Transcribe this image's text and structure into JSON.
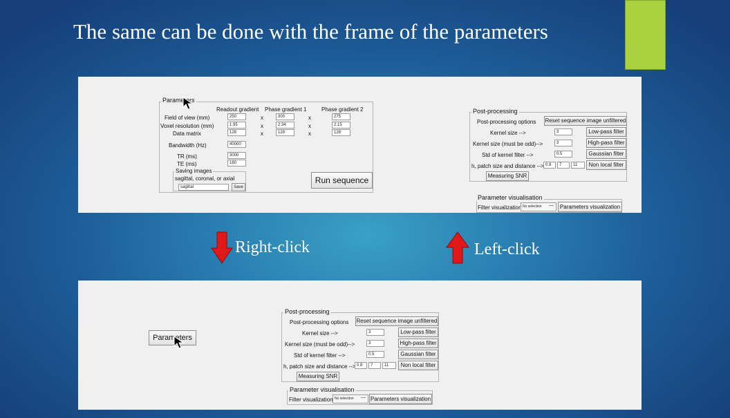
{
  "slide": {
    "title": "The same can be done with the frame of the parameters",
    "accent_color": "#a9d23e",
    "right_click_label": "Right-click",
    "left_click_label": "Left-click",
    "down_arrow_color": "#e01818",
    "up_arrow_color": "#e01818"
  },
  "parameters": {
    "legend": "Parameters",
    "col_readout": "Readout gradient",
    "col_phase1": "Phase gradient 1",
    "col_phase2": "Phase gradient 2",
    "rows": [
      {
        "label": "Field of view (mm)",
        "v1": "250",
        "v2": "300",
        "v3": "275"
      },
      {
        "label": "Voxel resolution (mm)",
        "v1": "1.95",
        "v2": "2.34",
        "v3": "2.15"
      },
      {
        "label": "Data matrix",
        "v1": "128",
        "v2": "128",
        "v3": "128"
      }
    ],
    "times_symbol": "x",
    "bandwidth_label": "Bandwidth (Hz)",
    "bandwidth_value": "40000",
    "tr_label": "TR (ms)",
    "tr_value": "3000",
    "te_label": "TE (ms)",
    "te_value": "160",
    "saving_legend": "Saving images",
    "saving_hint": "sagittal, coronal, or axial",
    "saving_value": "sagittal",
    "save_button": "Save",
    "run_button": "Run sequence"
  },
  "postprocessing": {
    "legend": "Post-processing",
    "options_label": "Post-processing options",
    "reset_button": "Reset sequence image unfiltered",
    "kernel_size_label": "Kernel size -->",
    "kernel_size_value": "3",
    "lowpass_button": "Low-pass filter",
    "kernel_odd_label": "Kernel size (must be odd)-->",
    "kernel_odd_value": "3",
    "highpass_button": "High-pass filter",
    "std_label": "Std of kernel filter -->",
    "std_value": "0.5",
    "gaussian_button": "Gaussian filter",
    "nlm_label": "h, patch size and distance -->",
    "nlm_h": "0.8",
    "nlm_patch": "7",
    "nlm_dist": "11",
    "nonlocal_button": "Non local filter",
    "snr_button": "Measuring SNR"
  },
  "visualisation": {
    "legend": "Parameter visualisation",
    "filter_label": "Filter visualization",
    "select_value": "No selection",
    "params_button": "Parameters visualization"
  },
  "collapsed": {
    "parameters_button": "Parameters"
  }
}
